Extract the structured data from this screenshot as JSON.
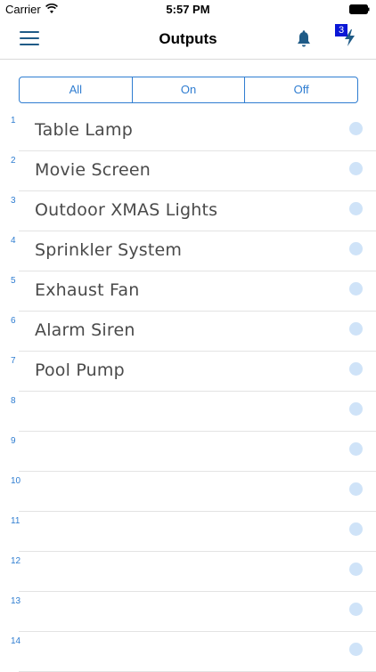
{
  "status_bar": {
    "carrier": "Carrier",
    "time": "5:57 PM"
  },
  "nav": {
    "title": "Outputs",
    "menu_icon": "hamburger-icon",
    "bell_icon": "bell-icon",
    "bolt_icon": "lightning-icon",
    "badge_count": "3",
    "accent_color": "#1f5b87"
  },
  "filter": {
    "all": "All",
    "on": "On",
    "off": "Off",
    "accent_color": "#2f7dd1"
  },
  "outputs": [
    {
      "number": "1",
      "label": "Table Lamp"
    },
    {
      "number": "2",
      "label": "Movie Screen"
    },
    {
      "number": "3",
      "label": "Outdoor XMAS Lights"
    },
    {
      "number": "4",
      "label": "Sprinkler System"
    },
    {
      "number": "5",
      "label": "Exhaust Fan"
    },
    {
      "number": "6",
      "label": "Alarm Siren"
    },
    {
      "number": "7",
      "label": "Pool Pump"
    },
    {
      "number": "8",
      "label": ""
    },
    {
      "number": "9",
      "label": ""
    },
    {
      "number": "10",
      "label": ""
    },
    {
      "number": "11",
      "label": ""
    },
    {
      "number": "12",
      "label": ""
    },
    {
      "number": "13",
      "label": ""
    },
    {
      "number": "14",
      "label": ""
    }
  ]
}
